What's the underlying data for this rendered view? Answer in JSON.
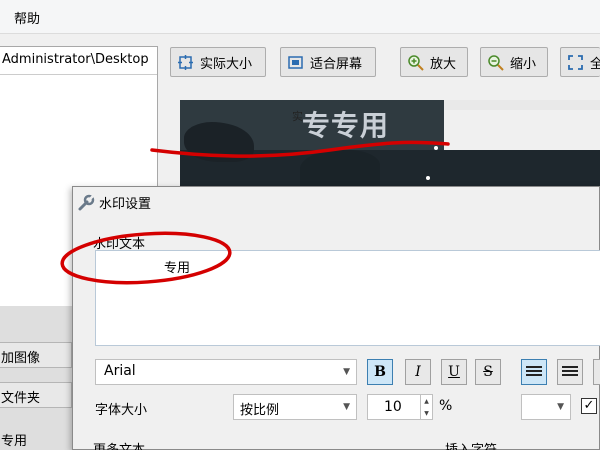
{
  "menu": {
    "help": "帮助"
  },
  "left_panel": {
    "path": "Administrator\\Desktop",
    "buttons": [
      "加图像",
      "文件夹"
    ],
    "bottom_label": "专用"
  },
  "toolbar": {
    "actual_size": "实际大小",
    "fit_screen": "适合屏幕",
    "zoom_in": "放大",
    "zoom_out": "缩小",
    "fullscreen_partial": "全"
  },
  "preview": {
    "watermark_text": "专专用",
    "watermark_small": "实"
  },
  "dialog": {
    "title": "水印设置",
    "text_label": "水印文本",
    "text_value": "专用",
    "font": "Arial",
    "bold": "B",
    "italic": "I",
    "underline": "U",
    "strike": "S",
    "size_label": "字体大小",
    "scale_mode": "按比例",
    "size_value": "10",
    "percent": "%",
    "more_text": "更多文本",
    "insert_char": "插入字符",
    "checkbox_checked": "✓"
  },
  "colors": {
    "accent": "#3c7fb1",
    "annotation": "#d40000"
  },
  "icons": [
    "wrench-icon",
    "actual-size-icon",
    "fit-screen-icon",
    "zoom-in-icon",
    "zoom-out-icon",
    "fullscreen-icon",
    "align-left-icon",
    "align-center-icon"
  ]
}
